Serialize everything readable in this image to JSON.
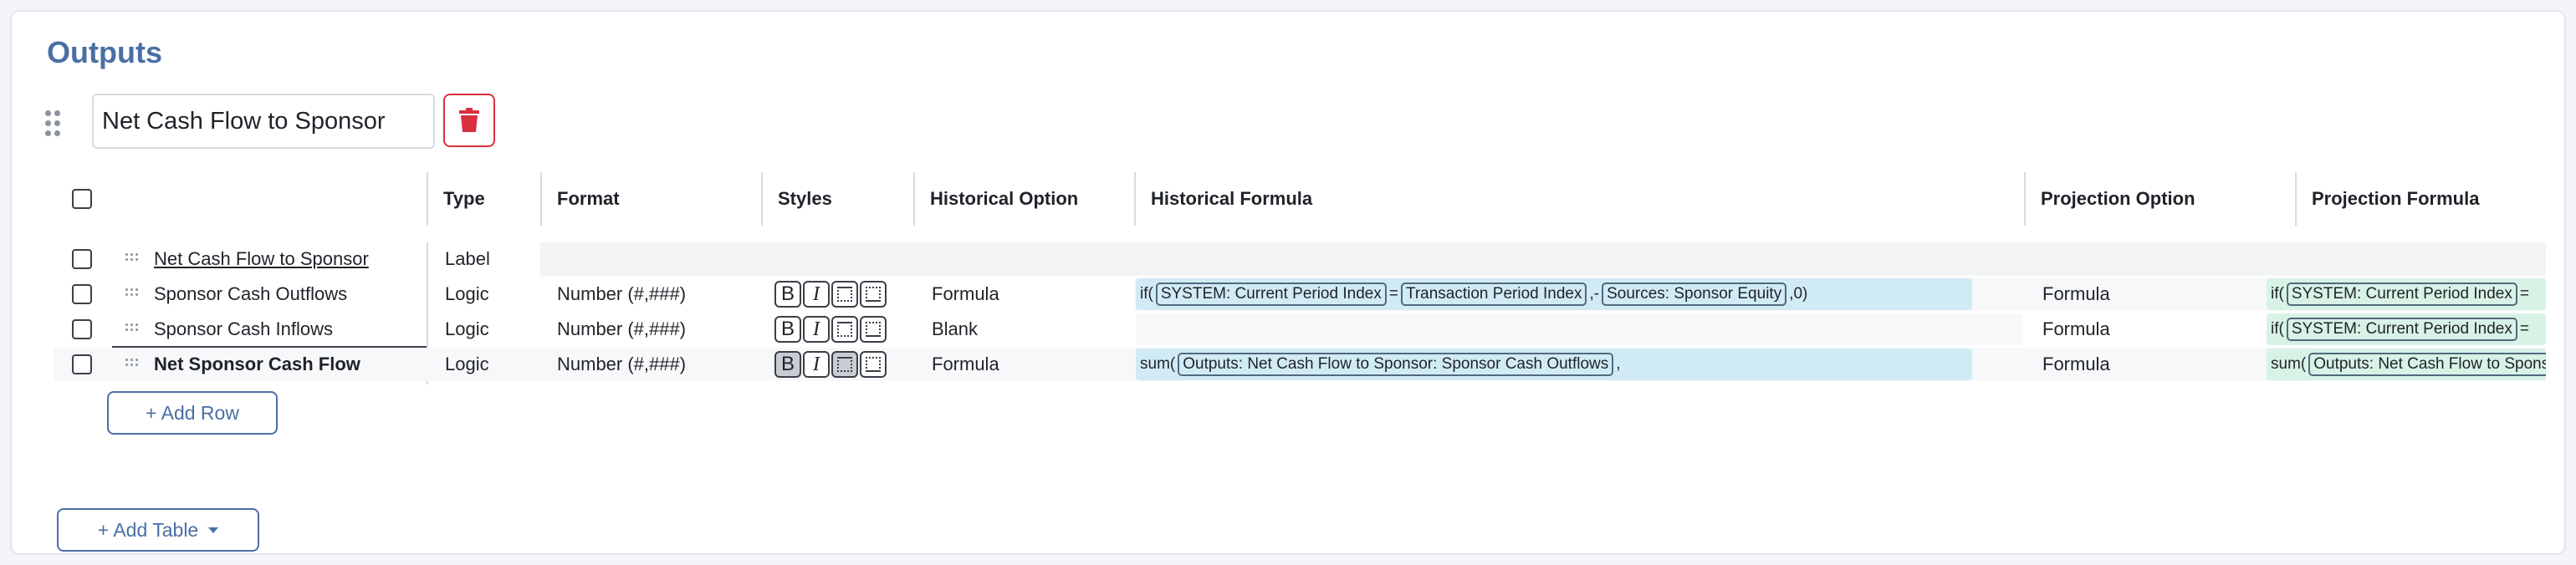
{
  "section": {
    "title": "Outputs"
  },
  "table": {
    "name_value": "Net Cash Flow to Sponsor"
  },
  "columns": {
    "type": "Type",
    "format": "Format",
    "styles": "Styles",
    "historical_option": "Historical Option",
    "historical_formula": "Historical Formula",
    "projection_option": "Projection Option",
    "projection_formula": "Projection Formula"
  },
  "rows": [
    {
      "name": "Net Cash Flow to Sponsor",
      "type": "Label"
    },
    {
      "name": "Sponsor Cash Outflows",
      "type": "Logic",
      "format": "Number (#,###)",
      "historical_option": "Formula",
      "projection_option": "Formula",
      "hist_formula": {
        "p1": "if(",
        "t1": "SYSTEM: Current Period Index",
        "p2": "=",
        "t2": "Transaction Period Index",
        "p3": ",-",
        "t3": "Sources: Sponsor Equity",
        "p4": ",0)"
      },
      "proj_formula": {
        "p1": "if(",
        "t1": "SYSTEM: Current Period Index",
        "p2": "="
      }
    },
    {
      "name": "Sponsor Cash Inflows",
      "type": "Logic",
      "format": "Number (#,###)",
      "historical_option": "Blank",
      "projection_option": "Formula",
      "proj_formula": {
        "p1": "if(",
        "t1": "SYSTEM: Current Period Index",
        "p2": "="
      }
    },
    {
      "name": "Net Sponsor Cash Flow",
      "type": "Logic",
      "format": "Number (#,###)",
      "historical_option": "Formula",
      "projection_option": "Formula",
      "hist_formula": {
        "p1": "sum(",
        "t1": "Outputs: Net Cash Flow to Sponsor: Sponsor Cash Outflows",
        "p2": ","
      },
      "proj_formula": {
        "p1": "sum(",
        "t1": "Outputs: Net Cash Flow to Sponsor: Sponsor Cash Outflows"
      }
    }
  ],
  "styles_glyphs": {
    "bold": "B",
    "italic": "I"
  },
  "buttons": {
    "add_row": "+ Add Row",
    "add_table": "+ Add Table"
  },
  "colors": {
    "accent": "#4a6fa5",
    "danger": "#d9303e",
    "hist_formula_bg": "#d1ebf5",
    "proj_formula_bg": "#d8f2e6"
  }
}
